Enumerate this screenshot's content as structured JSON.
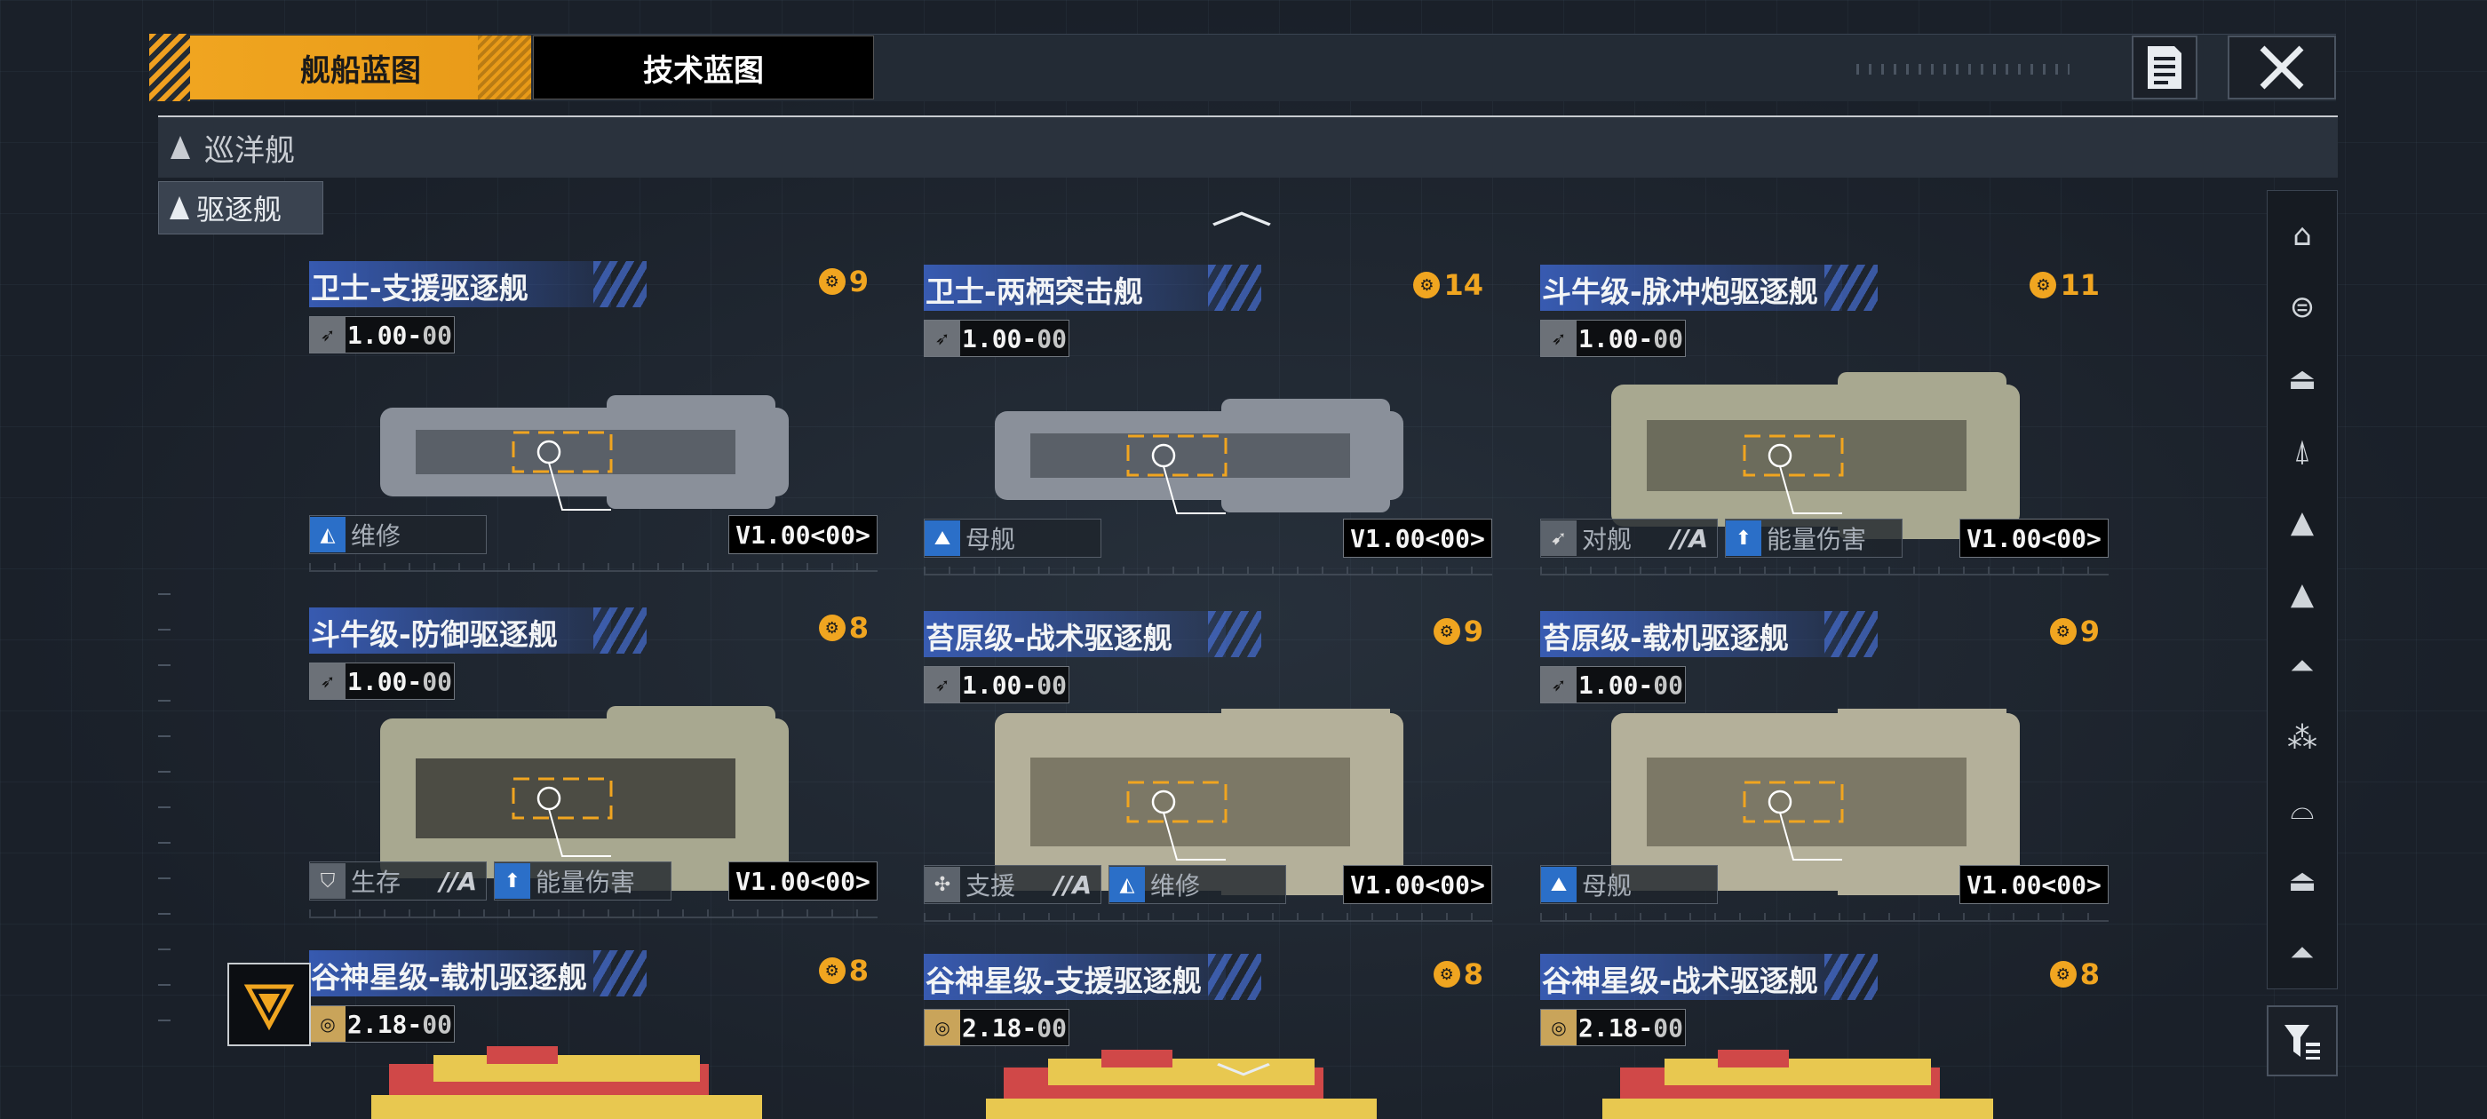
{
  "header": {
    "tabs": [
      {
        "label": "舰船蓝图",
        "active": true
      },
      {
        "label": "技术蓝图",
        "active": false
      }
    ],
    "doc_icon": "document-icon",
    "close_icon": "close-icon"
  },
  "categories": {
    "row_label": "巡洋舰",
    "selected_label": "驱逐舰"
  },
  "cards": [
    {
      "title": "卫士-支援驱逐舰",
      "cost": "9",
      "version": "1.00",
      "version_suffix": "00",
      "tags": [
        {
          "label": "维修",
          "suffix": ""
        }
      ],
      "ver_label": "V1.00<00>"
    },
    {
      "title": "卫士-两栖突击舰",
      "cost": "14",
      "version": "1.00",
      "version_suffix": "00",
      "tags": [
        {
          "label": "母舰",
          "suffix": ""
        }
      ],
      "ver_label": "V1.00<00>"
    },
    {
      "title": "斗牛级-脉冲炮驱逐舰",
      "cost": "11",
      "version": "1.00",
      "version_suffix": "00",
      "tags": [
        {
          "label": "对舰",
          "suffix": "//A"
        },
        {
          "label": "能量伤害",
          "suffix": ""
        }
      ],
      "ver_label": "V1.00<00>"
    },
    {
      "title": "斗牛级-防御驱逐舰",
      "cost": "8",
      "version": "1.00",
      "version_suffix": "00",
      "tags": [
        {
          "label": "生存",
          "suffix": "//A"
        },
        {
          "label": "能量伤害",
          "suffix": ""
        }
      ],
      "ver_label": "V1.00<00>"
    },
    {
      "title": "苔原级-战术驱逐舰",
      "cost": "9",
      "version": "1.00",
      "version_suffix": "00",
      "tags": [
        {
          "label": "支援",
          "suffix": "//A"
        },
        {
          "label": "维修",
          "suffix": ""
        }
      ],
      "ver_label": "V1.00<00>"
    },
    {
      "title": "苔原级-载机驱逐舰",
      "cost": "9",
      "version": "1.00",
      "version_suffix": "00",
      "tags": [
        {
          "label": "母舰",
          "suffix": ""
        }
      ],
      "ver_label": "V1.00<00>"
    },
    {
      "title": "谷神星级-载机驱逐舰",
      "cost": "8",
      "version": "2.18",
      "version_suffix": "00",
      "tags": [],
      "ver_label": ""
    },
    {
      "title": "谷神星级-支援驱逐舰",
      "cost": "8",
      "version": "2.18",
      "version_suffix": "00",
      "tags": [],
      "ver_label": ""
    },
    {
      "title": "谷神星级-战术驱逐舰",
      "cost": "8",
      "version": "2.18",
      "version_suffix": "00",
      "tags": [],
      "ver_label": ""
    }
  ],
  "right_nav": {
    "icons": [
      "carrier-icon",
      "battlecruiser-icon",
      "cruiser-icon",
      "cruiser-variant-icon",
      "destroyer-icon",
      "frigate-icon",
      "corvette-icon",
      "fighter-icon",
      "auxiliary-icon",
      "station-icon",
      "misc-icon"
    ],
    "filter_icon": "filter-icon"
  },
  "colors": {
    "accent": "#f0a520",
    "title_band": "#3c64c8",
    "tag_blue": "#2b6fc8",
    "bg": "#1a2029"
  }
}
